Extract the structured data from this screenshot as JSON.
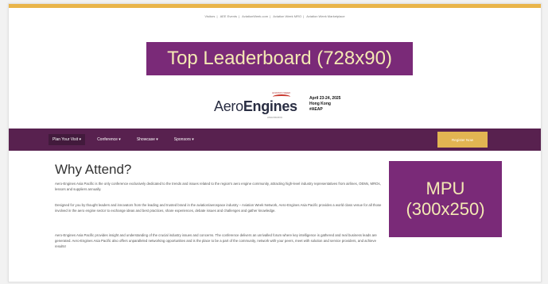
{
  "top_links": [
    "Visitors",
    "AEE Events",
    "AviationWeek.com",
    "Aviation Week MRO",
    "Aviation Week Marketplace"
  ],
  "leaderboard_label": "Top Leaderboard (728x90)",
  "logo": {
    "tagline": "AVIATION WEEK",
    "name_light": "Aero",
    "name_bold": "Engines",
    "sub": "ASIA PACIFIC"
  },
  "event": {
    "dates": "April 23-24, 2025",
    "location": "Hong Kong",
    "hashtag": "#AEAP"
  },
  "nav": [
    {
      "label": "Plan Your Visit ▾"
    },
    {
      "label": "Conference ▾"
    },
    {
      "label": "Showcase ▾"
    },
    {
      "label": "Sponsors ▾"
    }
  ],
  "register_label": "Register Now",
  "heading": "Why Attend?",
  "paragraphs": [
    "Aero-Engines Asia Pacific is the only conference exclusively dedicated to the trends and issues related to the region's aero engine community, attracting high-level industry representatives from airlines, OEMs, MROs, lessors and suppliers annually.",
    "Designed for you by thought leaders and innovators from the leading and trusted brand in the aviation/aerospace industry – Aviation Week Network, Aero-Engines Asia Pacific provides a world class venue for all those involved in the aero engine sector to exchange ideas and best practices, share experiences, debate issues and challenges and gather knowledge.",
    "Aero-Engines Asia Pacific provides insight and understanding of the crucial industry issues and concerns. The conference delivers an unrivalled forum where key intelligence is gathered and real business leads are generated. Aero-Engines Asia Pacific also offers unparalleled networking opportunities and is the place to be a part of the community, network with your peers, meet with solution and service providers, and achieve results!"
  ],
  "mpu": {
    "line1": "MPU",
    "line2": "(300x250)"
  }
}
